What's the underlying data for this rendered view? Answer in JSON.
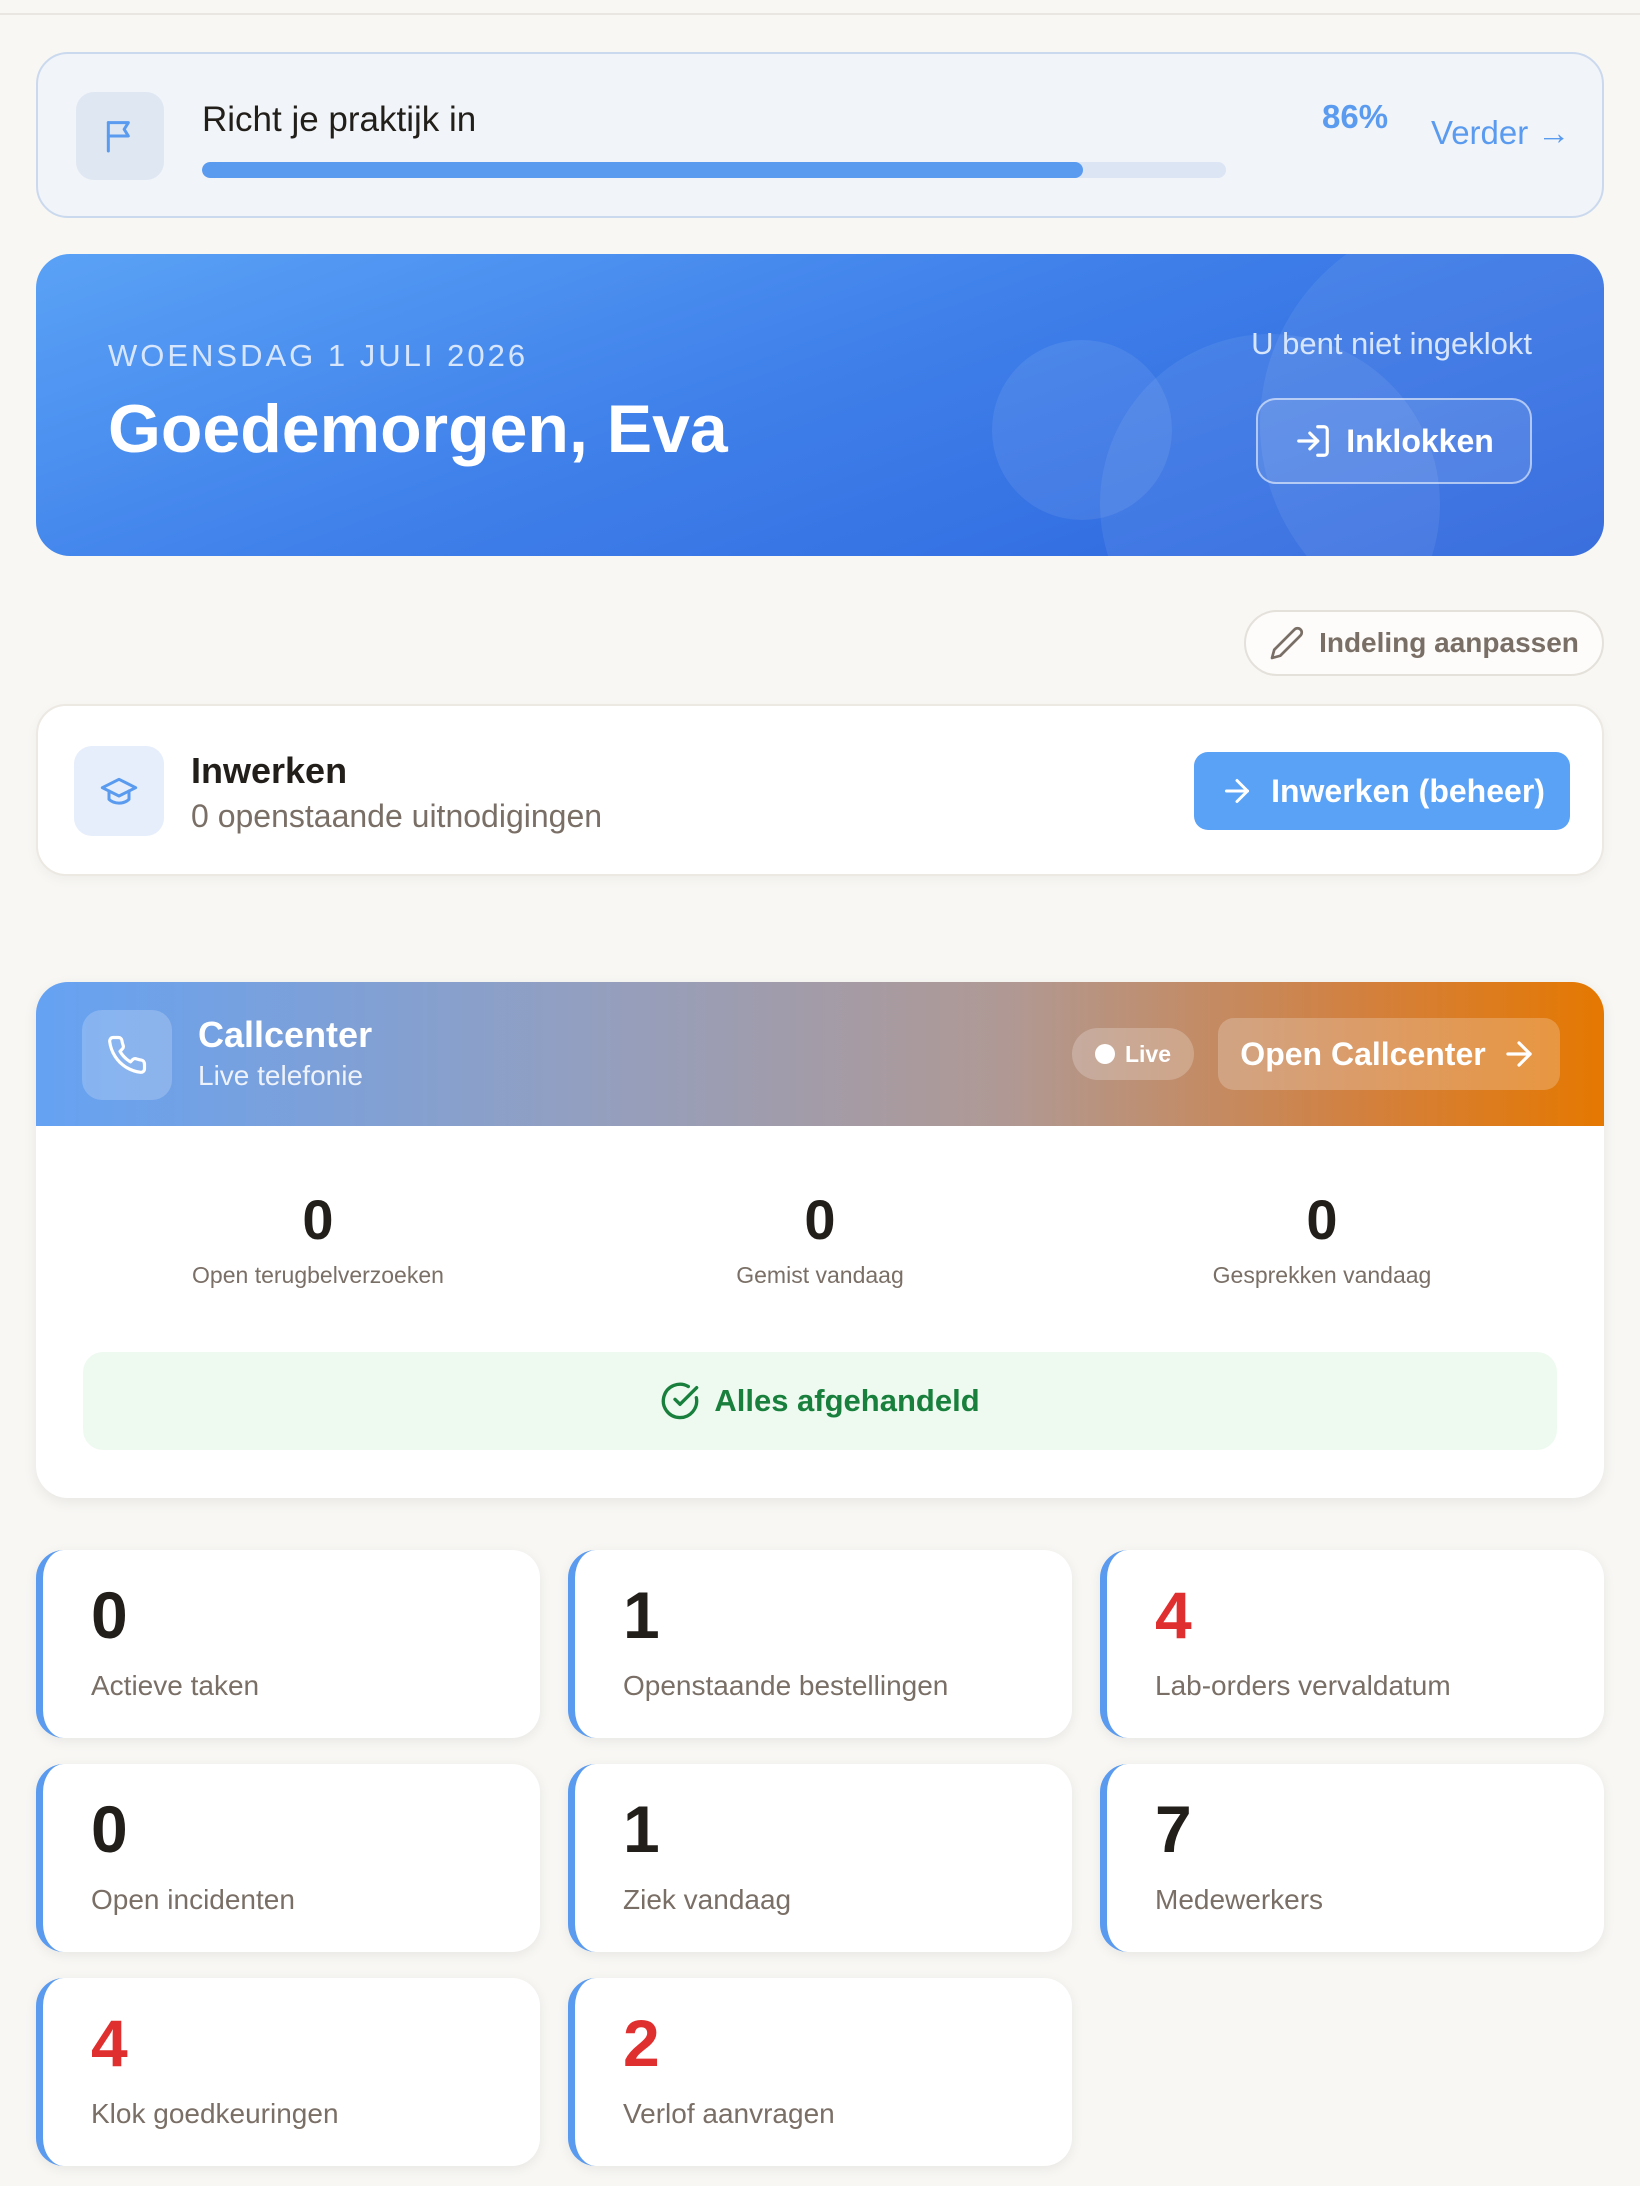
{
  "setup": {
    "title": "Richt je praktijk in",
    "progress_percent": 86,
    "progress_label": "86%",
    "continue_label": "Verder →"
  },
  "hero": {
    "date": "WOENSDAG 1 JULI 2026",
    "greeting": "Goedemorgen, Eva",
    "clock_status": "U bent niet ingeklokt",
    "clock_in_label": "Inklokken"
  },
  "layout_button_label": "Indeling aanpassen",
  "onboarding": {
    "title": "Inwerken",
    "subtitle": "0 openstaande uitnodigingen",
    "button_label": "Inwerken (beheer)"
  },
  "callcenter": {
    "title": "Callcenter",
    "subtitle": "Live telefonie",
    "live_label": "Live",
    "open_label": "Open Callcenter",
    "stats": [
      {
        "value": "0",
        "label": "Open terugbelverzoeken"
      },
      {
        "value": "0",
        "label": "Gemist vandaag"
      },
      {
        "value": "0",
        "label": "Gesprekken vandaag"
      }
    ],
    "status": "Alles afgehandeld"
  },
  "tiles": [
    {
      "value": "0",
      "label": "Actieve taken",
      "alert": false
    },
    {
      "value": "1",
      "label": "Openstaande bestellingen",
      "alert": false
    },
    {
      "value": "4",
      "label": "Lab-orders vervaldatum",
      "alert": true
    },
    {
      "value": "0",
      "label": "Open incidenten",
      "alert": false
    },
    {
      "value": "1",
      "label": "Ziek vandaag",
      "alert": false
    },
    {
      "value": "7",
      "label": "Medewerkers",
      "alert": false
    },
    {
      "value": "4",
      "label": "Klok goedkeuringen",
      "alert": true
    },
    {
      "value": "2",
      "label": "Verlof aanvragen",
      "alert": true
    }
  ],
  "colors": {
    "accent": "#5a9bf0",
    "alert": "#e02f2f",
    "success": "#18803c",
    "callcenter_gradient_end": "#e57800"
  },
  "icons": {
    "setup": "flag-icon",
    "clock_in": "login-icon",
    "layout": "pencil-icon",
    "onboarding": "graduation-cap-icon",
    "callcenter": "phone-icon",
    "status": "check-circle-icon"
  }
}
